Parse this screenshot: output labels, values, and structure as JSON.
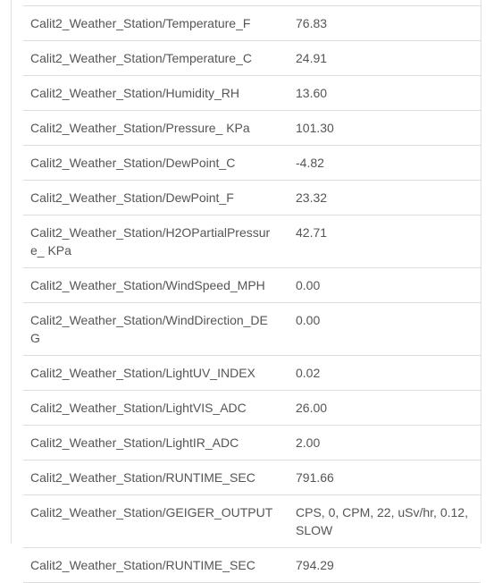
{
  "table": {
    "rows": [
      {
        "name": "Calit2_Weather_Station/Temperature_F",
        "value": "76.83"
      },
      {
        "name": "Calit2_Weather_Station/Temperature_C",
        "value": "24.91"
      },
      {
        "name": "Calit2_Weather_Station/Humidity_RH",
        "value": "13.60"
      },
      {
        "name": "Calit2_Weather_Station/Pressure_ KPa",
        "value": "101.30"
      },
      {
        "name": "Calit2_Weather_Station/DewPoint_C",
        "value": "-4.82"
      },
      {
        "name": "Calit2_Weather_Station/DewPoint_F",
        "value": "23.32"
      },
      {
        "name": "Calit2_Weather_Station/H2OPartialPressure_ KPa",
        "value": "42.71"
      },
      {
        "name": "Calit2_Weather_Station/WindSpeed_MPH",
        "value": "0.00"
      },
      {
        "name": "Calit2_Weather_Station/WindDirection_DEG",
        "value": "0.00"
      },
      {
        "name": "Calit2_Weather_Station/LightUV_INDEX",
        "value": "0.02"
      },
      {
        "name": "Calit2_Weather_Station/LightVIS_ADC",
        "value": "26.00"
      },
      {
        "name": "Calit2_Weather_Station/LightIR_ADC",
        "value": "2.00"
      },
      {
        "name": "Calit2_Weather_Station/RUNTIME_SEC",
        "value": "791.66"
      },
      {
        "name": "Calit2_Weather_Station/GEIGER_OUTPUT",
        "value": "CPS, 0, CPM, 22, uSv/hr, 0.12, SLOW"
      },
      {
        "name": "Calit2_Weather_Station/RUNTIME_SEC",
        "value": "794.29"
      }
    ]
  }
}
